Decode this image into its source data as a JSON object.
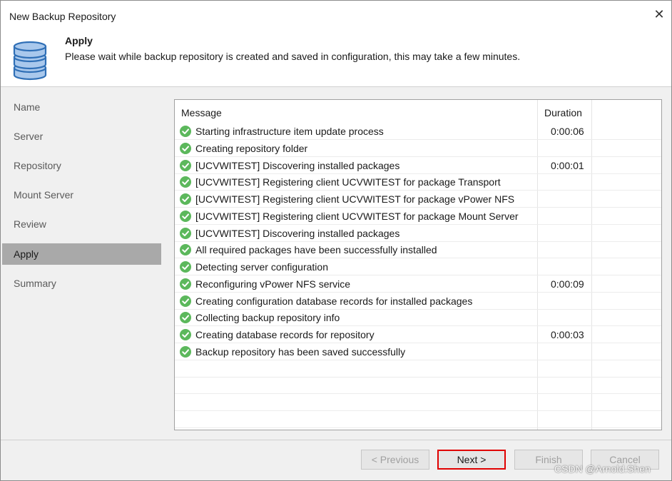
{
  "window": {
    "title": "New Backup Repository",
    "close_glyph": "✕"
  },
  "header": {
    "icon": "database-icon",
    "step_title": "Apply",
    "step_description": "Please wait while backup repository is created and saved in configuration, this may take a few minutes."
  },
  "sidebar": {
    "items": [
      {
        "label": "Name",
        "active": false
      },
      {
        "label": "Server",
        "active": false
      },
      {
        "label": "Repository",
        "active": false
      },
      {
        "label": "Mount Server",
        "active": false
      },
      {
        "label": "Review",
        "active": false
      },
      {
        "label": "Apply",
        "active": true
      },
      {
        "label": "Summary",
        "active": false
      }
    ]
  },
  "log": {
    "columns": [
      "Message",
      "Duration"
    ],
    "status_icon": "success-check-icon",
    "status_color": "#5cb85c",
    "rows": [
      {
        "message": "Starting infrastructure item update process",
        "duration": "0:00:06"
      },
      {
        "message": "Creating repository folder",
        "duration": ""
      },
      {
        "message": "[UCVWITEST] Discovering installed packages",
        "duration": "0:00:01"
      },
      {
        "message": "[UCVWITEST] Registering client UCVWITEST for package Transport",
        "duration": ""
      },
      {
        "message": "[UCVWITEST] Registering client UCVWITEST for package vPower NFS",
        "duration": ""
      },
      {
        "message": "[UCVWITEST] Registering client UCVWITEST for package Mount Server",
        "duration": ""
      },
      {
        "message": "[UCVWITEST] Discovering installed packages",
        "duration": ""
      },
      {
        "message": "All required packages have been successfully installed",
        "duration": ""
      },
      {
        "message": "Detecting server configuration",
        "duration": ""
      },
      {
        "message": "Reconfiguring vPower NFS service",
        "duration": "0:00:09"
      },
      {
        "message": "Creating configuration database records for installed packages",
        "duration": ""
      },
      {
        "message": "Collecting backup repository info",
        "duration": ""
      },
      {
        "message": "Creating database records for repository",
        "duration": "0:00:03"
      },
      {
        "message": "Backup repository has been saved successfully",
        "duration": ""
      }
    ]
  },
  "footer": {
    "previous_label": "< Previous",
    "next_label": "Next >",
    "finish_label": "Finish",
    "cancel_label": "Cancel",
    "highlight_color": "#e00000"
  },
  "watermark": "CSDN @Arnold.Shen"
}
